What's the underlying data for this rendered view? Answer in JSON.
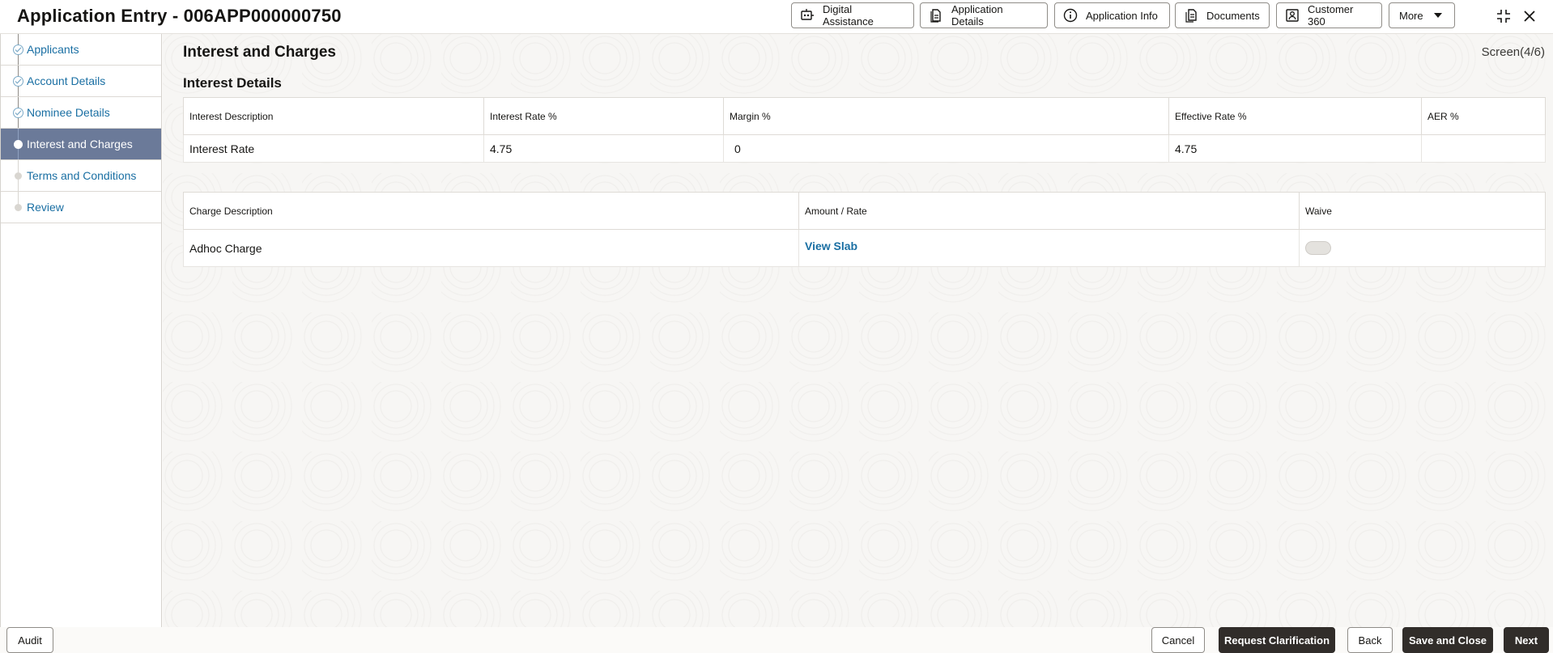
{
  "header": {
    "title": "Application Entry - 006APP000000750",
    "buttons": {
      "digital_assistance": "Digital Assistance",
      "application_details": "Application Details",
      "application_info": "Application Info",
      "documents": "Documents",
      "customer_360": "Customer 360",
      "more": "More"
    },
    "icons": [
      "robot-icon",
      "document-icon",
      "info-icon",
      "documents-icon",
      "contact-card-icon",
      "caret-down-icon",
      "collapse-icon",
      "close-icon"
    ]
  },
  "sidebar": {
    "steps": [
      {
        "label": "Applicants",
        "state": "done"
      },
      {
        "label": "Account Details",
        "state": "done"
      },
      {
        "label": "Nominee Details",
        "state": "done"
      },
      {
        "label": "Interest and Charges",
        "state": "active"
      },
      {
        "label": "Terms and Conditions",
        "state": "pending"
      },
      {
        "label": "Review",
        "state": "pending"
      }
    ]
  },
  "main": {
    "title": "Interest and Charges",
    "screen_counter": "Screen(4/6)",
    "interest_section_title": "Interest Details",
    "interest_table": {
      "columns": [
        "Interest Description",
        "Interest Rate %",
        "Margin %",
        "Effective Rate %",
        "AER %"
      ],
      "rows": [
        [
          "Interest Rate",
          "4.75",
          "0",
          "4.75",
          ""
        ]
      ]
    },
    "charges_table": {
      "columns": [
        "Charge Description",
        "Amount / Rate",
        "Waive"
      ],
      "rows": [
        {
          "description": "Adhoc Charge",
          "amount_link": "View Slab",
          "waive": false
        }
      ]
    }
  },
  "footer": {
    "audit": "Audit",
    "cancel": "Cancel",
    "request_clarification": "Request Clarification",
    "back": "Back",
    "save_and_close": "Save and Close",
    "next": "Next"
  },
  "colors": {
    "accent_link": "#1a6fa3",
    "active_step_bg": "#6b7a99",
    "solid_button_bg": "#312d2a"
  }
}
